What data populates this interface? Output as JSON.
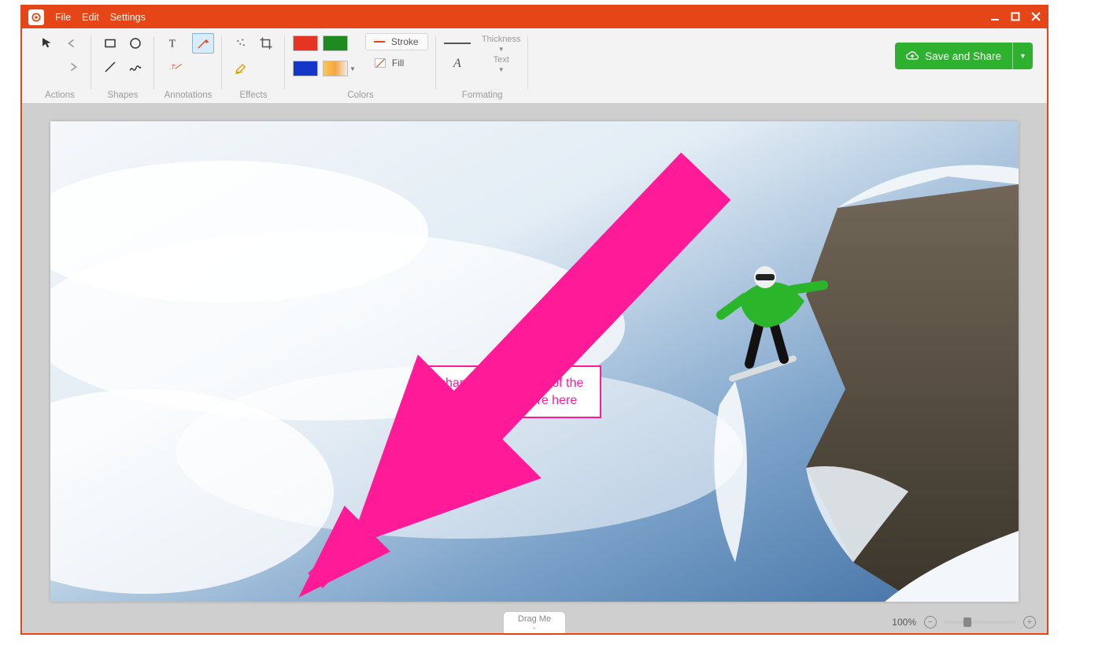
{
  "menubar": {
    "file": "File",
    "edit": "Edit",
    "settings": "Settings"
  },
  "ribbon_groups": {
    "actions": "Actions",
    "shapes": "Shapes",
    "annotations": "Annotations",
    "effects": "Effects",
    "colors": "Colors",
    "formatting": "Formating"
  },
  "colors": {
    "red": "#e73323",
    "green": "#1f8a1f",
    "blue": "#1436c9",
    "stroke_label": "Stroke",
    "fill_label": "Fill"
  },
  "formatting": {
    "thickness_label": "Thickness",
    "text_label": "Text"
  },
  "save_share_label": "Save and Share",
  "annotation": {
    "text": "change the position of the skier to somehwere here",
    "arrow_color": "#ff1b98"
  },
  "bottom": {
    "drag_label": "Drag Me",
    "zoom_percent": "100%"
  }
}
